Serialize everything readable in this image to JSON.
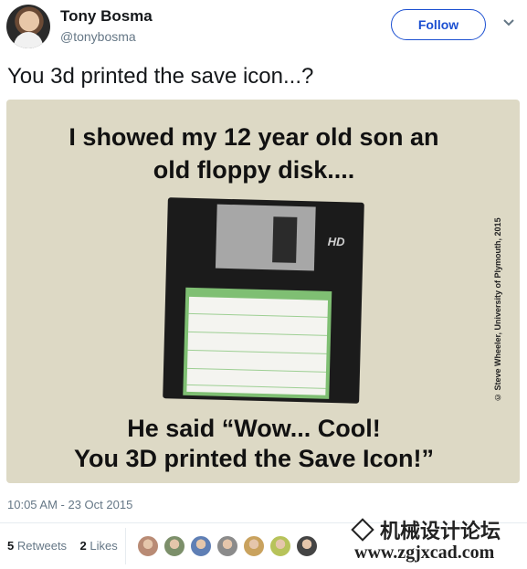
{
  "header": {
    "name": "Tony Bosma",
    "handle": "@tonybosma",
    "follow_label": "Follow"
  },
  "tweet": {
    "text": "You 3d printed the save icon...?",
    "date": "10:05 AM - 23 Oct 2015",
    "retweets_count": "5",
    "retweets_label": "Retweets",
    "likes_count": "2",
    "likes_label": "Likes"
  },
  "media": {
    "line1": "I showed my 12 year old son an",
    "line2": "old floppy disk....",
    "line3": "He said “Wow... Cool!",
    "line4": "You 3D printed the Save Icon!”",
    "credit": "© Steve Wheeler, University of Plymouth, 2015",
    "disk_mark": "HD"
  },
  "likers": [
    "#b98b75",
    "#7c8f6a",
    "#5f7fb5",
    "#8b8b8b",
    "#c9a25e",
    "#b7c35a",
    "#444444"
  ],
  "watermark": {
    "site_name": "机械设计论坛",
    "url": "www.zgjxcad.com"
  },
  "colors": {
    "accent": "#1b4fd1",
    "muted": "#657786",
    "media_bg": "#ddd9c5"
  },
  "icons": [
    "chevron-down-icon"
  ]
}
